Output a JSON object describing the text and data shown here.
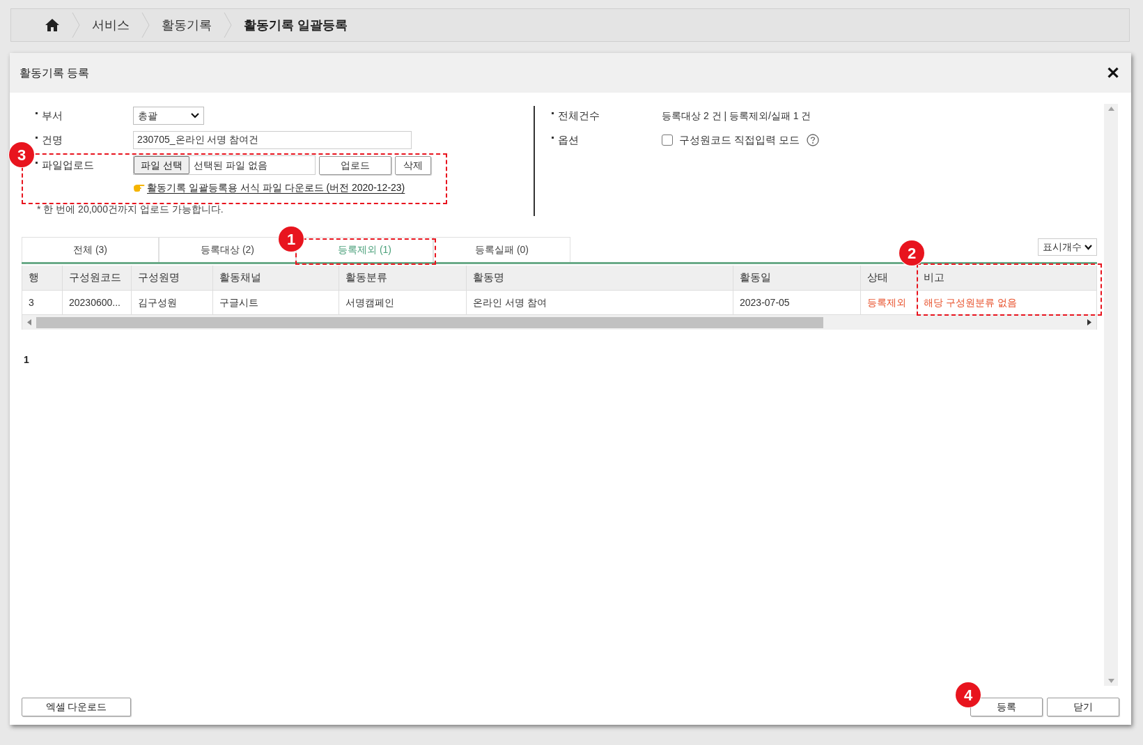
{
  "breadcrumb": [
    "서비스",
    "활동기록",
    "활동기록 일괄등록"
  ],
  "dialog": {
    "title": "활동기록 등록",
    "close": "✕"
  },
  "form": {
    "department": {
      "label": "부서",
      "value": "총괄"
    },
    "subject": {
      "label": "건명",
      "value": "230705_온라인 서명 참여건"
    },
    "upload": {
      "label": "파일업로드",
      "choose": "파일 선택",
      "file_status": "선택된 파일 없음",
      "upload_button": "업로드",
      "delete_button": "삭제",
      "template_link": "활동기록 일괄등록용 서식 파일 다운로드 (버전 2020-12-23)"
    },
    "note": "* 한 번에 20,000건까지 업로드 가능합니다.",
    "total": {
      "label": "전체건수",
      "value": "등록대상 2 건 | 등록제외/실패 1 건"
    },
    "option": {
      "label": "옵션",
      "checkbox_label": "구성원코드 직접입력 모드",
      "checked": false
    }
  },
  "tabs": [
    {
      "label": "전체 (3)",
      "selected": false
    },
    {
      "label": "등록대상 (2)",
      "selected": false
    },
    {
      "label": "등록제외 (1)",
      "selected": true
    },
    {
      "label": "등록실패 (0)",
      "selected": false
    }
  ],
  "page_size": "표시개수",
  "table": {
    "columns": [
      "행",
      "구성원코드",
      "구성원명",
      "활동채널",
      "활동분류",
      "활동명",
      "활동일",
      "상태",
      "비고"
    ],
    "rows": [
      {
        "cells": [
          {
            "text": "3",
            "kind": "normal"
          },
          {
            "text": "20230600...",
            "kind": "normal"
          },
          {
            "text": "김구성원",
            "kind": "normal"
          },
          {
            "text": "구글시트",
            "kind": "normal"
          },
          {
            "text": "서명캠페인",
            "kind": "normal"
          },
          {
            "text": "온라인 서명 참여",
            "kind": "normal"
          },
          {
            "text": "2023-07-05",
            "kind": "normal"
          },
          {
            "text": "등록제외",
            "kind": "error"
          },
          {
            "text": "해당 구성원분류 없음",
            "kind": "error"
          }
        ]
      }
    ]
  },
  "pagination": [
    "1"
  ],
  "footer": {
    "excel": "엑셀 다운로드",
    "register": "등록",
    "close": "닫기"
  },
  "annotations": [
    {
      "number": "1",
      "kind": "framed"
    },
    {
      "number": "2",
      "kind": "framed"
    },
    {
      "number": "3",
      "kind": "framed"
    },
    {
      "number": "4",
      "kind": "badge"
    }
  ]
}
